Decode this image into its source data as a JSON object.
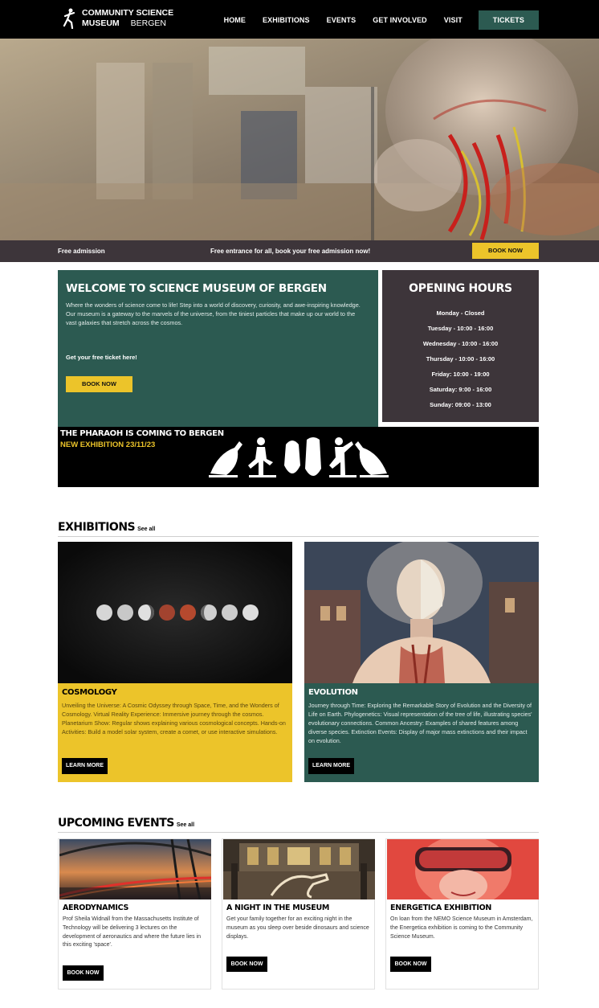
{
  "header": {
    "logo_line1": "COMMUNITY SCIENCE",
    "logo_line2": "MUSEUM",
    "logo_city": "BERGEN",
    "nav": [
      "HOME",
      "EXHIBITIONS",
      "EVENTS",
      "GET INVOLVED",
      "VISIT"
    ],
    "tickets_label": "TICKETS"
  },
  "ticker": {
    "left": "Free admission",
    "middle": "Free entrance for all, book your free admission now!",
    "button": "BOOK NOW"
  },
  "welcome": {
    "title": "WELCOME TO SCIENCE MUSEUM OF BERGEN",
    "description": "Where the wonders of science come to life! Step into a world of discovery, curiosity, and awe-inspiring knowledge. Our museum is a gateway to the marvels of the universe, from the tiniest particles that make up our world to the vast galaxies that stretch across the cosmos.",
    "free_ticket": "Get your free ticket here!",
    "button": "BOOK NOW"
  },
  "hours": {
    "title": "OPENING HOURS",
    "days": [
      "Monday - Closed",
      "Tuesday - 10:00 - 16:00",
      "Wednesday - 10:00 - 16:00",
      "Thursday - 10:00 - 16:00",
      "Friday: 10:00 - 19:00",
      "Saturday: 9:00 - 16:00",
      "Sunday: 09:00 - 13:00"
    ]
  },
  "pharaoh": {
    "title": "THE PHARAOH IS COMING TO BERGEN",
    "subtitle": "NEW EXHIBITION 23/11/23"
  },
  "exhibitions": {
    "title": "EXHIBITIONS",
    "see_all": "See all",
    "items": [
      {
        "title": "COSMOLOGY",
        "description": "Unveiling the Universe: A Cosmic Odyssey through Space, Time, and the Wonders of Cosmology. Virtual Reality Experience: Immersive journey through the cosmos. Planetarium Show: Regular shows explaining various cosmological concepts. Hands-on Activities: Build a model solar system, create a comet, or use interactive simulations.",
        "button": "LEARN MORE",
        "bg": "#ecc42a"
      },
      {
        "title": "EVOLUTION",
        "description": "Journey through Time: Exploring the Remarkable Story of Evolution and the Diversity of Life on Earth. Phylogenetics: Visual representation of the tree of life, illustrating species' evolutionary connections. Common Ancestry: Examples of shared features among diverse species. Extinction Events: Display of major mass extinctions and their impact on evolution.",
        "button": "LEARN MORE",
        "bg": "#2c5a51"
      }
    ]
  },
  "events": {
    "title": "UPCOMING EVENTS",
    "see_all": "See all",
    "items": [
      {
        "title": "AERODYNAMICS",
        "description": "Prof Sheila Widnall from the Massachusetts Institute of Technology will be delivering 3 lectures on the development of aeronautics and where the future lies in this exciting 'space'.",
        "button": "BOOK NOW"
      },
      {
        "title": "A NIGHT IN THE MUSEUM",
        "description": "Get your family together for an exciting night in the museum as you sleep over beside dinosaurs and science displays.",
        "button": "BOOK NOW"
      },
      {
        "title": "ENERGETICA EXHIBITION",
        "description": "On loan from the NEMO Science Museum in Amsterdam, the Energetica exhibition is coming to the Community Science Museum.",
        "button": "BOOK NOW"
      }
    ]
  },
  "colors": {
    "teal": "#2c5a51",
    "yellow": "#ecc42a",
    "plum": "#3d353a",
    "black": "#000000"
  }
}
